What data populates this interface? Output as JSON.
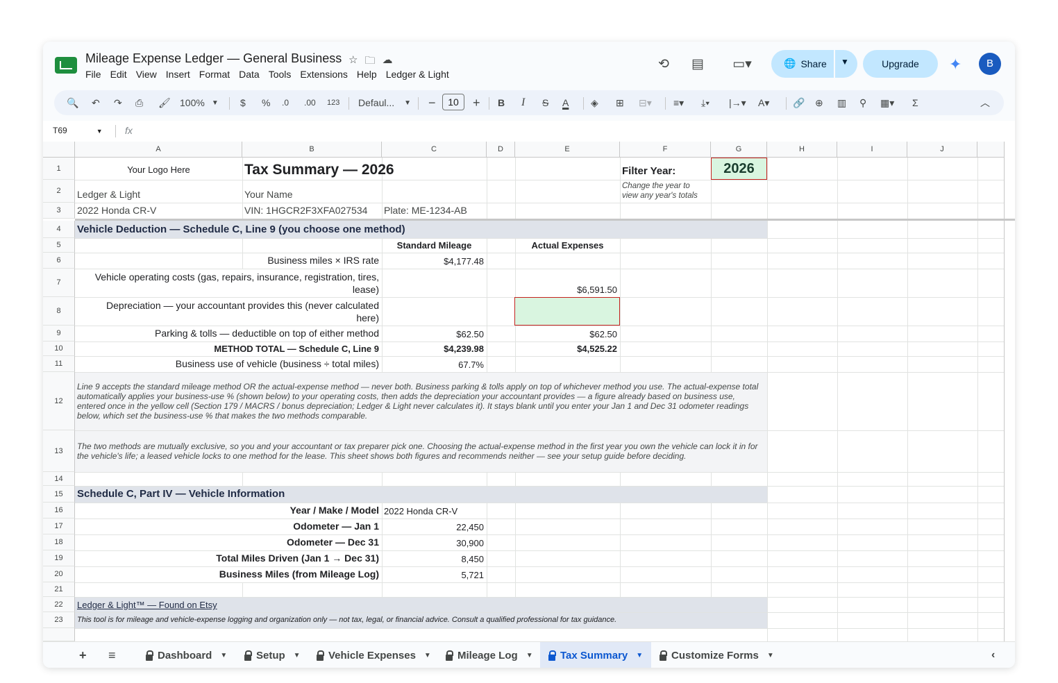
{
  "app": {
    "title": "Mileage Expense Ledger — General Business",
    "menu": [
      "File",
      "Edit",
      "View",
      "Insert",
      "Format",
      "Data",
      "Tools",
      "Extensions",
      "Help",
      "Ledger & Light"
    ],
    "share_label": "Share",
    "upgrade_label": "Upgrade",
    "avatar_initial": "B"
  },
  "toolbar": {
    "zoom": "100%",
    "currency": "$",
    "percent": "%",
    "dec_minus": ".0",
    "dec_plus": ".00",
    "format_123": "123",
    "font": "Defaul...",
    "font_size": "10",
    "bold": "B",
    "italic": "I",
    "strike": "S",
    "text_color": "A",
    "sigma": "Σ"
  },
  "formula_bar": {
    "name_box": "T69",
    "fx": "fx"
  },
  "columns": [
    "A",
    "B",
    "C",
    "D",
    "E",
    "F",
    "G",
    "H",
    "I",
    "J"
  ],
  "rows": [
    "1",
    "2",
    "3",
    "4",
    "5",
    "6",
    "7",
    "8",
    "9",
    "10",
    "11",
    "12",
    "13",
    "14",
    "15",
    "16",
    "17",
    "18",
    "19",
    "20",
    "21",
    "22",
    "23"
  ],
  "sheet": {
    "logo": "Your Logo Here",
    "heading": "Tax Summary — 2026",
    "filter_label": "Filter Year:",
    "filter_year": "2026",
    "filter_hint_1": "Change the year to",
    "filter_hint_2": "view any year's totals",
    "business": "Ledger & Light",
    "your_name": "Your Name",
    "vehicle": "2022 Honda CR-V",
    "vin": "VIN: 1HGCR2F3XFA027534",
    "plate": "Plate: ME-1234-AB",
    "section1": "Vehicle Deduction — Schedule C, Line 9 (you choose one method)",
    "std_header": "Standard Mileage",
    "actual_header": "Actual Expenses",
    "r6_label": "Business miles × IRS rate",
    "r6_std": "$4,177.48",
    "r7_label_1": "Vehicle operating costs (gas, repairs, insurance, registration, tires,",
    "r7_label_2": "lease)",
    "r7_actual": "$6,591.50",
    "r8_label_1": "Depreciation — your accountant provides this (never calculated",
    "r8_label_2": "here)",
    "r9_label": "Parking & tolls — deductible on top of either method",
    "r9_std": "$62.50",
    "r9_actual": "$62.50",
    "r10_label": "METHOD TOTAL — Schedule C, Line 9",
    "r10_std": "$4,239.98",
    "r10_actual": "$4,525.22",
    "r11_label": "Business use of vehicle (business ÷ total miles)",
    "r11_val": "67.7%",
    "note12": "Line 9 accepts the standard mileage method OR the actual-expense method — never both. Business parking & tolls apply on top of whichever method you use. The actual-expense total automatically applies your business-use % (shown below) to your operating costs, then adds the depreciation your accountant provides — a figure already based on business use, entered once in the yellow cell (Section 179 / MACRS / bonus depreciation; Ledger & Light never calculates it). It stays blank until you enter your Jan 1 and Dec 31 odometer readings below, which set the business-use % that makes the two methods comparable.",
    "note13": "The two methods are mutually exclusive, so you and your accountant or tax preparer pick one. Choosing the actual-expense method in the first year you own the vehicle can lock it in for the vehicle's life; a leased vehicle locks to one method for the lease. This sheet shows both figures and recommends neither — see your setup guide before deciding.",
    "section2": "Schedule C, Part IV — Vehicle Information",
    "r16_label": "Year / Make / Model",
    "r16_val": "2022 Honda CR-V",
    "r17_label": "Odometer — Jan 1",
    "r17_val": "22,450",
    "r18_label": "Odometer — Dec 31",
    "r18_val": "30,900",
    "r19_label": "Total Miles Driven (Jan 1 → Dec 31)",
    "r19_val": "8,450",
    "r20_label": "Business Miles (from Mileage Log)",
    "r20_val": "5,721",
    "footer_link": "Ledger & Light™  —  Found on Etsy",
    "disclaimer": "This tool is for mileage and vehicle-expense logging and organization only — not tax, legal, or financial advice. Consult a qualified professional for tax guidance."
  },
  "tabs": [
    "Dashboard",
    "Setup",
    "Vehicle Expenses",
    "Mileage Log",
    "Tax Summary",
    "Customize Forms"
  ],
  "active_tab": "Tax Summary",
  "colors": {
    "accent": "#0b57d0",
    "band": "#dfe3ea",
    "input_green": "#d9f5e0",
    "share_bg": "#c2e7ff"
  }
}
